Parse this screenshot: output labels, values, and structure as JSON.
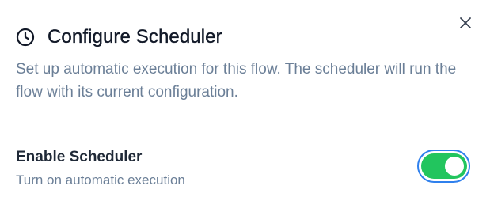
{
  "dialog": {
    "title": "Configure Scheduler",
    "title_icon": "clock-icon",
    "close_icon": "close-icon",
    "description": "Set up automatic execution for this flow. The scheduler will run the flow with its current configuration."
  },
  "setting": {
    "label": "Enable Scheduler",
    "sublabel": "Turn on automatic execution",
    "enabled": true
  },
  "colors": {
    "toggle_on": "#22c55e",
    "focus_ring": "#2f80ed",
    "muted_text": "#6b7f97"
  }
}
